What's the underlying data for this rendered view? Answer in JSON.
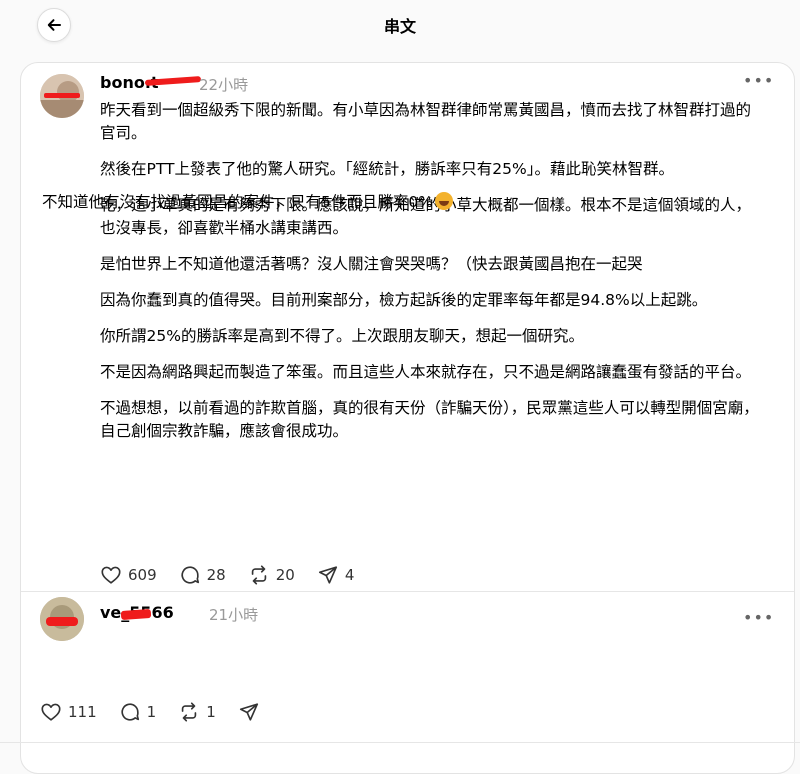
{
  "header": {
    "title": "串文"
  },
  "posts": [
    {
      "username": "bono.t",
      "time": "22小時",
      "paragraphs": [
        "昨天看到一個超級秀下限的新聞。有小草因為林智群律師常罵黃國昌，憤而去找了林智群打過的官司。",
        "然後在PTT上發表了他的驚人研究。「經統計，勝訴率只有25%」。藉此恥笑林智群。",
        "乾，這小草真的是有夠秀下限。應該說，所知道的小草大概都一個樣。根本不是這個領域的人，也沒專長，卻喜歡半桶水講東講西。",
        "是怕世界上不知道他還活著嗎？沒人關注會哭哭嗎？（快去跟黃國昌抱在一起哭",
        "因為你蠢到真的值得哭。目前刑案部分，檢方起訴後的定罪率每年都是94.8%以上起跳。",
        "你所謂25%的勝訴率是高到不得了。上次跟朋友聊天，想起一個研究。",
        "不是因為網路興起而製造了笨蛋。而且這些人本來就存在，只不過是網路讓蠢蛋有發話的平台。",
        "不過想想，以前看過的詐欺首腦，真的很有天份（詐騙天份），民眾黨這些人可以轉型開個宮廟，自己創個宗教詐騙，應該會很成功。"
      ],
      "likes": "609",
      "replies": "28",
      "reposts": "20",
      "shares": "4"
    },
    {
      "username": "ve_5566",
      "time": "21小時",
      "text": "不知道他有沒有找過黃國昌的案件，只有5件而且勝率0%",
      "likes": "111",
      "replies": "1",
      "reposts": "1"
    }
  ],
  "icons": {
    "back": "arrow-left-icon",
    "more": "more-horizontal-icon",
    "like": "heart-icon",
    "reply": "comment-icon",
    "repost": "repost-icon",
    "share": "send-icon",
    "emoji": "rolling-laughing-emoji"
  },
  "colors": {
    "background": "#fafafa",
    "card": "#ffffff",
    "muted_text": "#999999",
    "redaction": "#ef1c1c"
  }
}
